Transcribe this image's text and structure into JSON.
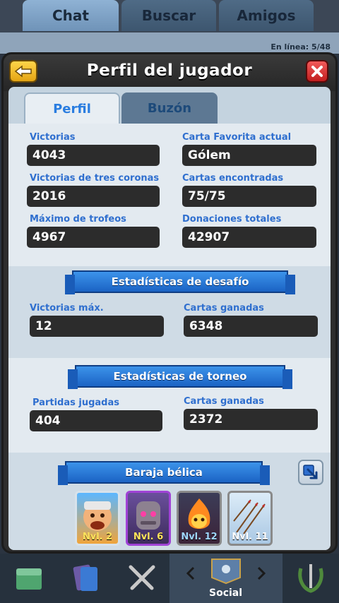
{
  "top_tabs": [
    "Chat",
    "Buscar",
    "Amigos"
  ],
  "background_online_text": "En línea: 5/48",
  "modal": {
    "title": "Perfil del jugador",
    "tabs": [
      "Perfil",
      "Buzón"
    ]
  },
  "stats": {
    "victorias_label": "Victorias",
    "victorias_value": "4043",
    "carta_favorita_label": "Carta Favorita actual",
    "carta_favorita_value": "Gólem",
    "tres_coronas_label": "Victorias de tres coronas",
    "tres_coronas_value": "2016",
    "cartas_encontradas_label": "Cartas encontradas",
    "cartas_encontradas_value": "75/75",
    "max_trofeos_label": "Máximo de trofeos",
    "max_trofeos_value": "4967",
    "donaciones_label": "Donaciones totales",
    "donaciones_value": "42907"
  },
  "challenge": {
    "title": "Estadísticas de desafío",
    "victorias_max_label": "Victorias máx.",
    "victorias_max_value": "12",
    "cartas_ganadas_label": "Cartas ganadas",
    "cartas_ganadas_value": "6348"
  },
  "tournament": {
    "title": "Estadísticas de torneo",
    "partidas_label": "Partidas jugadas",
    "partidas_value": "404",
    "cartas_ganadas_label": "Cartas ganadas",
    "cartas_ganadas_value": "2372"
  },
  "deck": {
    "title": "Baraja bélica",
    "cards": [
      {
        "level": "Nvl. 2",
        "icon": "giant-card",
        "border": "#d8e2ea"
      },
      {
        "level": "Nvl. 6",
        "icon": "golem-card",
        "border": "#a043d6"
      },
      {
        "level": "Nvl. 12",
        "icon": "fire-spirit-card",
        "border": "#8a8a8a"
      },
      {
        "level": "Nvl. 11",
        "icon": "arrows-card",
        "border": "#8a8a8a"
      }
    ]
  },
  "bottom_nav": {
    "social_label": "Social"
  },
  "colors": {
    "accent_blue": "#2f6fcf",
    "ribbon_blue": "#1b63c4",
    "value_bg": "#2c2c2c"
  }
}
